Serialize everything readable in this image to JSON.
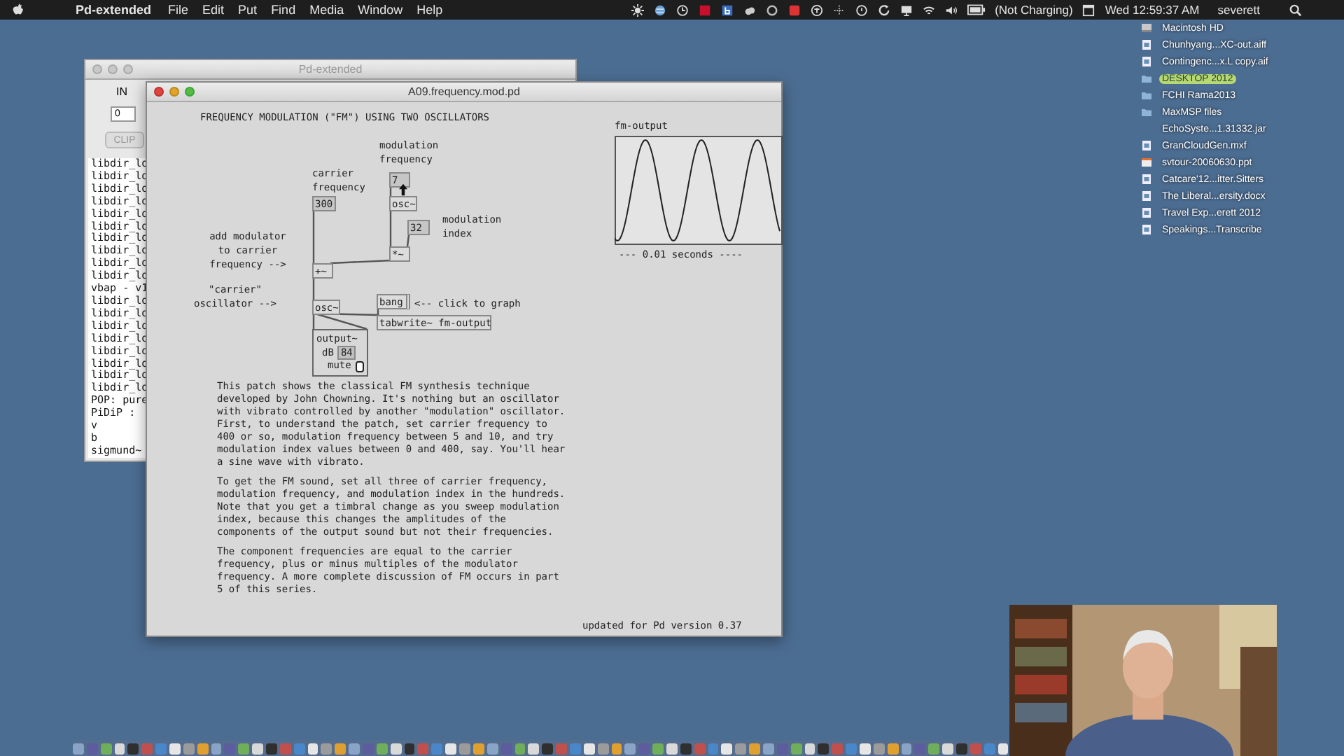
{
  "menu_bar": {
    "app": "Pd-extended",
    "menus": [
      "File",
      "Edit",
      "Put",
      "Find",
      "Media",
      "Window",
      "Help"
    ],
    "battery": "(Not Charging)",
    "clock": "Wed 12:59:37 AM",
    "user": "severett"
  },
  "desktop_icons": [
    {
      "label": "Macintosh HD",
      "kind": "disk",
      "selected": false
    },
    {
      "label": "Chunhyang...XC-out.aiff",
      "kind": "file",
      "selected": false
    },
    {
      "label": "Contingenc...x.L copy.aif",
      "kind": "file",
      "selected": false
    },
    {
      "label": "DESKTOP 2012",
      "kind": "folder",
      "selected": true
    },
    {
      "label": "FCHI Rama2013",
      "kind": "folder",
      "selected": false
    },
    {
      "label": "MaxMSP files",
      "kind": "folder",
      "selected": false
    },
    {
      "label": "EchoSyste...1.31332.jar",
      "kind": "none",
      "selected": false
    },
    {
      "label": "GranCloudGen.mxf",
      "kind": "file",
      "selected": false
    },
    {
      "label": "svtour-20060630.ppt",
      "kind": "slides",
      "selected": false
    },
    {
      "label": "Catcare'12...itter.Sitters",
      "kind": "file",
      "selected": false
    },
    {
      "label": "The Liberal...ersity.docx",
      "kind": "file",
      "selected": false
    },
    {
      "label": "Travel Exp...erett 2012",
      "kind": "file",
      "selected": false
    },
    {
      "label": "Speakings...Transcribe",
      "kind": "file",
      "selected": false
    }
  ],
  "pd_window": {
    "title": "Pd-extended",
    "in_label": "IN",
    "in_value": "0",
    "clip_button": "CLIP",
    "log": [
      "libdir_lo",
      "libdir_lo",
      "libdir_lo",
      "libdir_lo",
      "libdir_lo",
      "libdir_lo",
      "libdir_lo",
      "libdir_lo",
      "libdir_lo",
      "libdir_lo",
      "vbap - v1",
      "libdir_lo",
      "libdir_lo",
      "libdir_lo",
      "libdir_lo",
      "libdir_lo",
      "libdir_lo",
      "libdir_lo",
      "libdir_lo",
      "POP: pure",
      "PiDiP :",
      "v",
      "b",
      "sigmund~"
    ]
  },
  "patch_window": {
    "title": "A09.frequency.mod.pd",
    "heading": "FREQUENCY MODULATION (\"FM\") USING TWO OSCILLATORS",
    "objects": [
      {
        "kind": "comment",
        "text": "modulation frequency"
      },
      {
        "kind": "comment",
        "text": "carrier frequency"
      },
      {
        "kind": "number",
        "text": "7"
      },
      {
        "kind": "object",
        "text": "osc~"
      },
      {
        "kind": "number",
        "text": "300"
      },
      {
        "kind": "number",
        "text": "32"
      },
      {
        "kind": "comment",
        "text": "modulation index"
      },
      {
        "kind": "comment",
        "text": "add modulator to carrier frequency -->"
      },
      {
        "kind": "object",
        "text": "*~"
      },
      {
        "kind": "object",
        "text": "+~"
      },
      {
        "kind": "comment",
        "text": "\"carrier\" oscillator -->"
      },
      {
        "kind": "message",
        "text": "bang"
      },
      {
        "kind": "comment",
        "text": "<-- click to graph"
      },
      {
        "kind": "object",
        "text": "osc~"
      },
      {
        "kind": "object",
        "text": "tabwrite~ fm-output"
      },
      {
        "kind": "output",
        "text": "output~",
        "db_label": "dB",
        "db_value": "84",
        "mute_label": "mute"
      }
    ],
    "graph": {
      "name": "fm-output",
      "caption": "--- 0.01 seconds ----"
    },
    "paragraphs": [
      "This patch shows the classical FM synthesis technique developed by John Chowning. It's nothing but an oscillator with vibrato controlled by another \"modulation\" oscillator. First, to understand the patch, set carrier frequency to 400 or so, modulation frequency between 5 and 10, and try modulation index values between 0 and 400, say. You'll hear a sine wave with vibrato.",
      "To get the FM sound, set all three of carrier frequency, modulation frequency, and modulation index in the hundreds. Note that you get a timbral change as you sweep modulation index, because this changes the amplitudes of the components of the output sound but not their frequencies.",
      "The component frequencies are equal to the carrier frequency, plus or minus multiples of the modulator frequency. A more complete discussion of FM occurs in part 5 of this series."
    ],
    "footer": "updated for Pd version 0.37"
  }
}
